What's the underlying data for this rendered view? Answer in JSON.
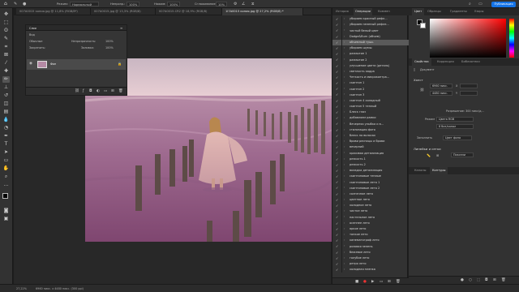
{
  "options_bar": {
    "mode_label": "Режим:",
    "mode_value": "Нормальный",
    "opacity_label": "Непрозр.:",
    "opacity_value": "100%",
    "flow_label": "Нажим:",
    "flow_value": "100%",
    "smoothing_label": "Сглаживание:",
    "smoothing_value": "10%",
    "publish_label": "Публикация"
  },
  "tabs": [
    {
      "label": "007A0015 копия.jpg @ 11,8% (RGB/8*)",
      "active": false
    },
    {
      "label": "007A0015.jpg @ 13,3% (RGB/8)",
      "active": false
    },
    {
      "label": "007A0015.CR2 @ 18,9% (RGB/8)",
      "active": false
    },
    {
      "label": "1I7A0015 копия.jpg @ 27,2% (RGB/8) *",
      "active": true
    }
  ],
  "layers_panel": {
    "title": "Слои",
    "kind_label": "Вид",
    "mode_label": "Обычные",
    "opacity_label": "Непрозрачность:",
    "opacity_value": "100%",
    "lock_label": "Закрепить:",
    "fill_label": "Заливка:",
    "fill_value": "100%",
    "layer_name": "Фон"
  },
  "history": {
    "tabs": [
      "История",
      "Операции",
      "Коммен"
    ],
    "active_tab": 1,
    "selected_index": 4,
    "actions": [
      "убираем красный рефл...",
      "убираем зеленый рефле...",
      "чистый белый цвет",
      "Dodge&Burn (объем)",
      "объемный тушь",
      "убираем шумы",
      "размытие 1",
      "размытие 2",
      "улучшение цвета (деталь)",
      "светлость кадра",
      "Четкость и микроконтра...",
      "скинтон 1",
      "скинтон 2",
      "скинтон 3",
      "скинтон 4 холодный",
      "скинтон 5 теплый",
      "Блеск глаз",
      "добавляем рамки",
      "Вечерняя улыбка и в...",
      "стилизация фото",
      "блеск на волосах",
      "брови ресницы и брови",
      "вечерний",
      "красивая детализация",
      "резкость 1",
      "резкость 2",
      "вкладка детализация",
      "скинтоновые теплые",
      "скинтоновые лето 1",
      "скинтоновые лето 2",
      "солнечное лето",
      "цветное лето",
      "холодное лето",
      "чистое лето",
      "пастельное лето",
      "осеннее лето",
      "яркое лето",
      "тонкое лето",
      "кинематограф лето",
      "розовая зелень",
      "бежевое лето",
      "голубое лето",
      "ретро лето",
      "холодная пленка"
    ]
  },
  "color_panel": {
    "tabs": [
      "Цвет",
      "Образцы",
      "Градиенты",
      "Узоры"
    ],
    "active_tab": 0,
    "hue": "#ff0000"
  },
  "properties_panel": {
    "tabs": [
      "Свойства",
      "Коррекция",
      "Библиотеки"
    ],
    "active_tab": 0,
    "doc_label": "Документ",
    "canvas_label": "Холст",
    "width_value": "6960 пикс.",
    "height_value": "4480 пикс.",
    "x_label": "X",
    "y_label": "Y",
    "resolution_label": "Разрешение: 300 пикс/д...",
    "mode_label": "Режим",
    "mode_value": "Цвета RGB",
    "bits_value": "8 бит/канал",
    "fill_label": "Заполнить",
    "fill_value": "Цвет фона",
    "rulers_label": "Линейки и сетки",
    "units_value": "Пиксели"
  },
  "paths_panel": {
    "tabs": [
      "Каналы",
      "Контуры"
    ],
    "active_tab": 1
  },
  "status": {
    "zoom": "27,22%",
    "size": "6960 пикс. x 4480 пикс. (300 ppi)"
  }
}
